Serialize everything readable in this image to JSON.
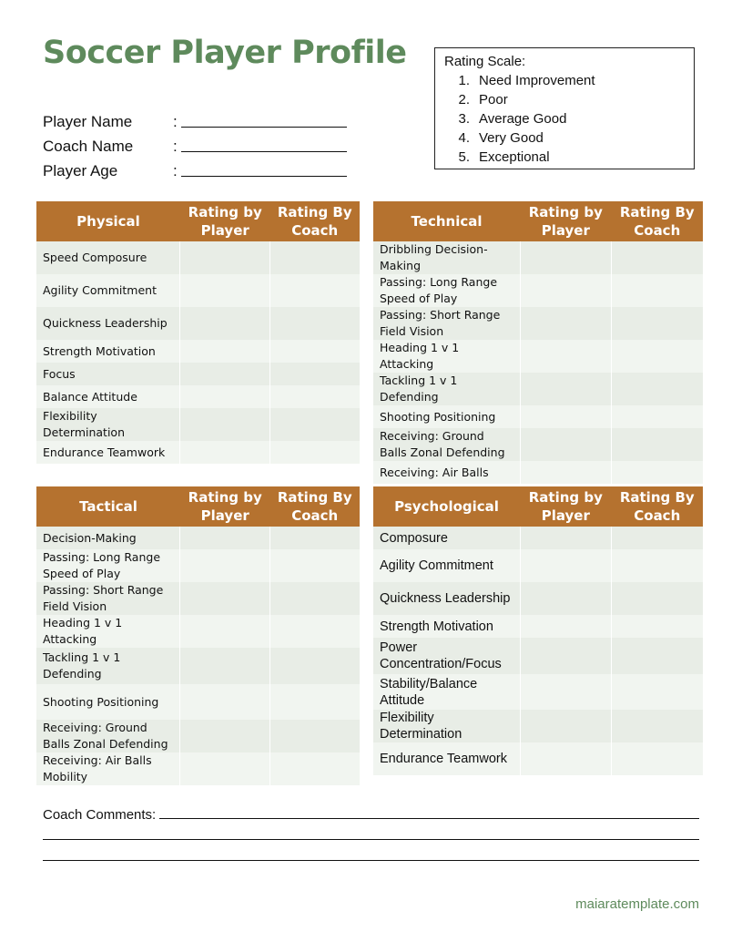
{
  "title": "Soccer Player Profile",
  "fields": [
    {
      "label": "Player Name",
      "colon": ":",
      "value": ""
    },
    {
      "label": "Coach Name",
      "colon": ":",
      "value": ""
    },
    {
      "label": "Player Age",
      "colon": ":",
      "value": ""
    }
  ],
  "rating_scale": {
    "heading": "Rating Scale:",
    "items": [
      {
        "num": "1.",
        "label": "Need Improvement"
      },
      {
        "num": "2.",
        "label": "Poor"
      },
      {
        "num": "3.",
        "label": "Average Good"
      },
      {
        "num": "4.",
        "label": "Very Good"
      },
      {
        "num": "5.",
        "label": "Exceptional"
      }
    ]
  },
  "colors": {
    "header": "#B5722F",
    "title": "#5E8A5C",
    "row_odd": "#E8EDE6",
    "row_even": "#F1F5F0"
  },
  "tables": {
    "physical": {
      "headers": [
        "Physical",
        "Rating by Player",
        "Rating By Coach"
      ],
      "rows": [
        "Speed Composure",
        "Agility Commitment",
        "Quickness Leadership",
        "Strength Motivation",
        "Focus",
        "Balance Attitude",
        "Flexibility Determination",
        "Endurance Teamwork"
      ]
    },
    "technical": {
      "headers": [
        "Technical",
        "Rating by Player",
        "Rating By Coach"
      ],
      "rows": [
        "Dribbling Decision-Making",
        "Passing: Long Range Speed of Play",
        "Passing: Short Range Field Vision",
        "Heading 1 v 1 Attacking",
        "Tackling 1 v 1 Defending",
        "Shooting Positioning",
        "Receiving: Ground Balls Zonal Defending",
        "Receiving: Air Balls"
      ]
    },
    "tactical": {
      "headers": [
        "Tactical",
        "Rating by Player",
        "Rating By Coach"
      ],
      "rows": [
        "Decision-Making",
        "Passing: Long Range Speed of Play",
        "Passing: Short Range Field Vision",
        "Heading 1 v 1 Attacking",
        "Tackling 1 v 1 Defending",
        "Shooting Positioning",
        "Receiving: Ground Balls Zonal Defending",
        "Receiving: Air Balls Mobility"
      ]
    },
    "psychological": {
      "headers": [
        "Psychological",
        "Rating by Player",
        "Rating By Coach"
      ],
      "rows": [
        "Composure",
        "Agility Commitment",
        "Quickness Leadership",
        "Strength Motivation",
        "Power Concentration/Focus",
        "Stability/Balance Attitude",
        "Flexibility Determination",
        "Endurance Teamwork"
      ]
    }
  },
  "comments": {
    "label": "Coach Comments:",
    "value": ""
  },
  "footer": "maiaratemplate.com"
}
